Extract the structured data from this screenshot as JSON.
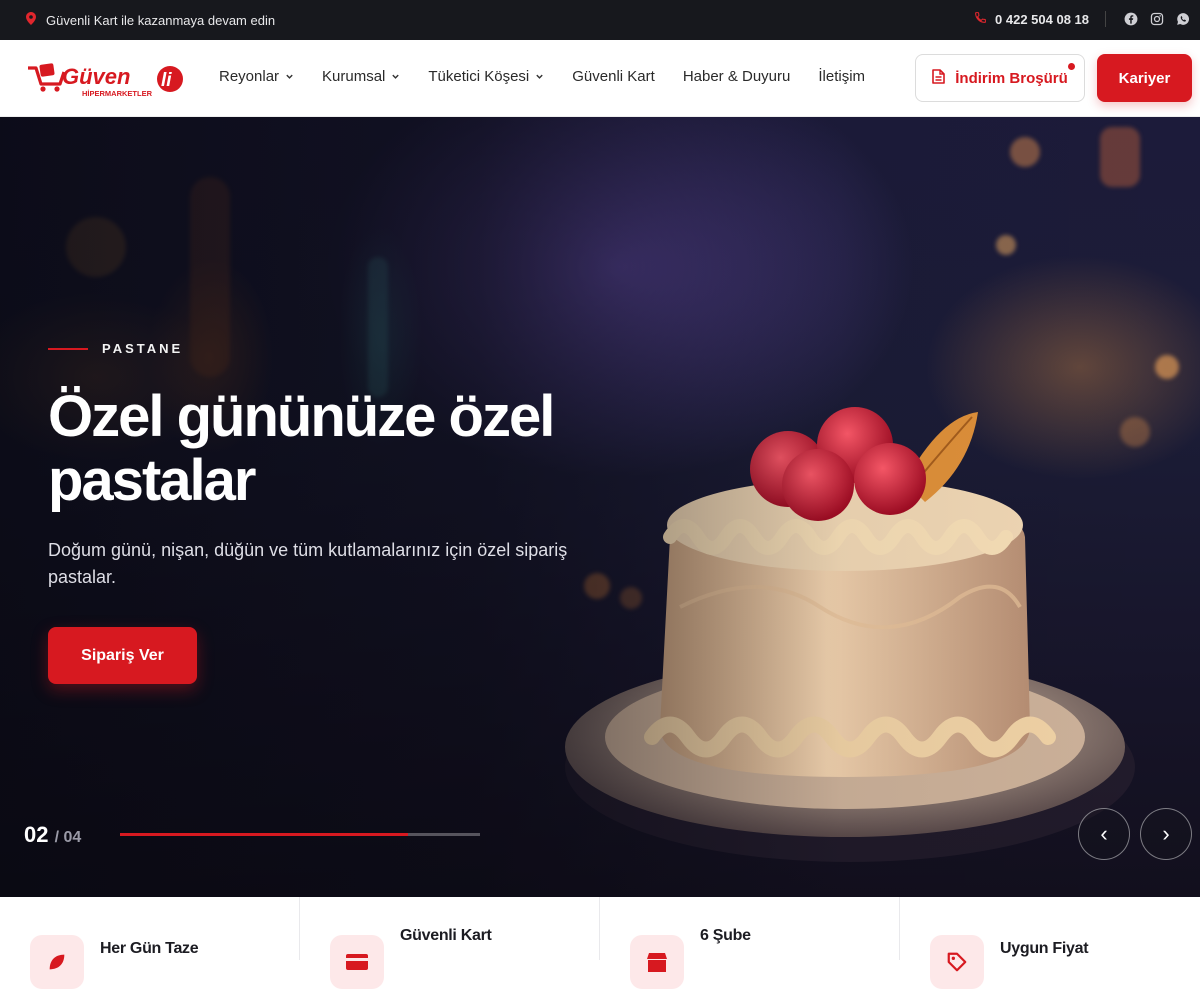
{
  "topbar": {
    "promo_text": "Güvenli Kart ile kazanmaya devam edin",
    "phone": "0 422 504 08 18",
    "social": [
      "facebook-icon",
      "instagram-icon",
      "whatsapp-icon"
    ]
  },
  "header": {
    "logo_text": "Güvenli",
    "logo_subtext": "HİPERMARKETLER",
    "nav": [
      {
        "label": "Reyonlar",
        "dropdown": true
      },
      {
        "label": "Kurumsal",
        "dropdown": true
      },
      {
        "label": "Tüketici Köşesi",
        "dropdown": true
      },
      {
        "label": "Güvenli Kart",
        "dropdown": false
      },
      {
        "label": "Haber & Duyuru",
        "dropdown": false
      },
      {
        "label": "İletişim",
        "dropdown": false
      }
    ],
    "brochure_label": "İndirim Broşürü",
    "career_label": "Kariyer"
  },
  "hero": {
    "eyebrow": "PASTANE",
    "title": "Özel gününüze özel pastalar",
    "subtitle": "Doğum günü, nişan, düğün ve tüm kutlamalarınız için özel sipariş pastalar.",
    "cta_label": "Sipariş Ver",
    "slide_current": "02",
    "slide_total": "/ 04",
    "progress_fraction": 0.8,
    "prev_label": "‹",
    "next_label": "›"
  },
  "features": [
    {
      "title": "Her Gün Taze",
      "description": "",
      "icon": "leaf-icon"
    },
    {
      "title": "Güvenli Kart",
      "description": "",
      "icon": "card-icon"
    },
    {
      "title": "6 Şube",
      "description": "",
      "icon": "store-icon"
    },
    {
      "title": "Uygun Fiyat",
      "description": "",
      "icon": "tag-icon"
    }
  ],
  "colors": {
    "brand_red": "#d71920",
    "topbar_bg": "#17181d",
    "hero_bg": "#1b1c36"
  }
}
